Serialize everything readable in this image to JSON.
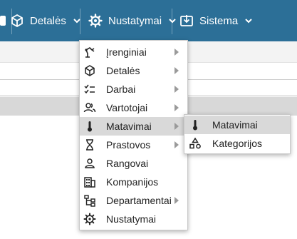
{
  "topnav": {
    "details_label": "Detalės",
    "settings_label": "Nustatymai",
    "system_label": "Sistema"
  },
  "menu": {
    "items": [
      {
        "label": "Įrenginiai",
        "icon": "robot-arm-icon",
        "has_submenu": true
      },
      {
        "label": "Detalės",
        "icon": "cube-icon",
        "has_submenu": true
      },
      {
        "label": "Darbai",
        "icon": "checklist-icon",
        "has_submenu": true
      },
      {
        "label": "Vartotojai",
        "icon": "users-icon",
        "has_submenu": true
      },
      {
        "label": "Matavimai",
        "icon": "thermometer-icon",
        "has_submenu": true
      },
      {
        "label": "Prastovos",
        "icon": "hourglass-icon",
        "has_submenu": true
      },
      {
        "label": "Rangovai",
        "icon": "person-icon",
        "has_submenu": false
      },
      {
        "label": "Kompanijos",
        "icon": "building-icon",
        "has_submenu": false
      },
      {
        "label": "Departamentai",
        "icon": "org-chart-icon",
        "has_submenu": true
      },
      {
        "label": "Nustatymai",
        "icon": "gear-icon",
        "has_submenu": false
      }
    ]
  },
  "submenu": {
    "items": [
      {
        "label": "Matavimai",
        "icon": "thermometer-icon"
      },
      {
        "label": "Kategorijos",
        "icon": "shapes-icon"
      }
    ]
  },
  "colors": {
    "topbar": "#2c6f97",
    "highlight": "#d9d9d9"
  }
}
